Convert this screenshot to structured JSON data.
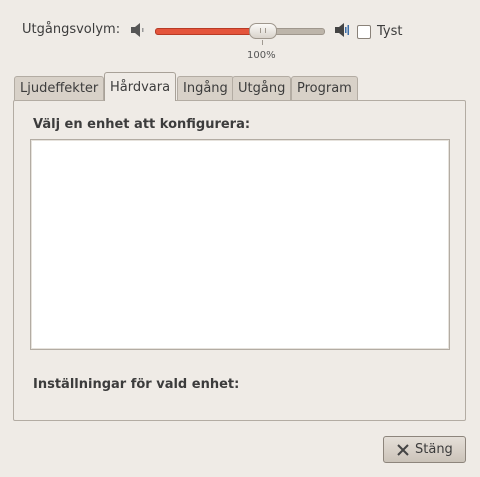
{
  "volume": {
    "label": "Utgångsvolym:",
    "percent_text": "100%",
    "level": 0.63,
    "mute_label": "Tyst",
    "mute_checked": false,
    "fill_color": "#e4543b"
  },
  "tabs": [
    {
      "label": "Ljudeffekter",
      "active": false
    },
    {
      "label": "Hårdvara",
      "active": true
    },
    {
      "label": "Ingång",
      "active": false
    },
    {
      "label": "Utgång",
      "active": false
    },
    {
      "label": "Program",
      "active": false
    }
  ],
  "hardware": {
    "device_heading": "Välj en enhet att konfigurera:",
    "settings_heading": "Inställningar för vald enhet:"
  },
  "footer": {
    "close_label": "Stäng"
  }
}
